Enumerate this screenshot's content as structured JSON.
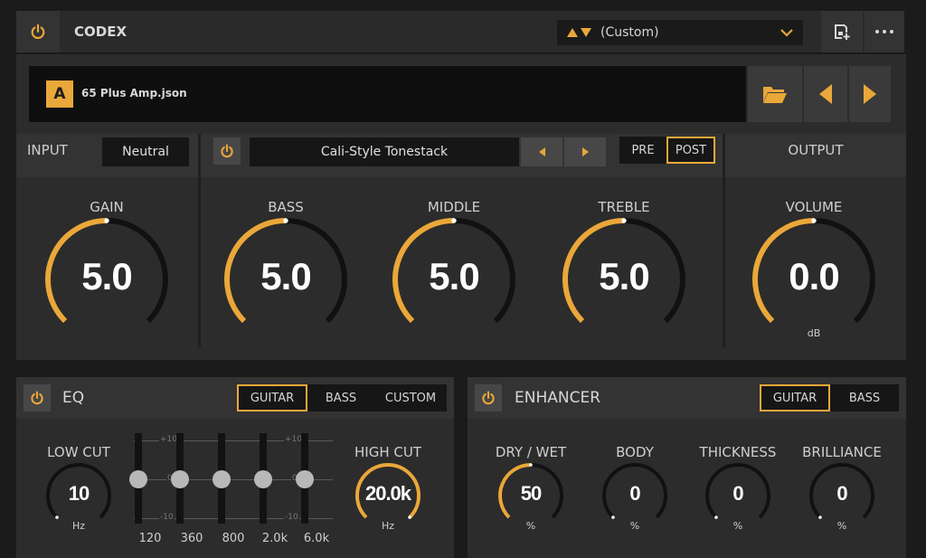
{
  "header": {
    "title": "CODEX",
    "preset": "(Custom)"
  },
  "model": {
    "badge": "A",
    "file": "65 Plus Amp.json"
  },
  "input": {
    "label": "INPUT",
    "mode": "Neutral"
  },
  "tonestack": {
    "name": "Cali-Style Tonestack",
    "pre": "PRE",
    "post": "POST",
    "active": "POST"
  },
  "output": {
    "label": "OUTPUT"
  },
  "knobs": {
    "gain": {
      "label": "GAIN",
      "value": "5.0",
      "level": 0.5
    },
    "bass": {
      "label": "BASS",
      "value": "5.0",
      "level": 0.5
    },
    "middle": {
      "label": "MIDDLE",
      "value": "5.0",
      "level": 0.5
    },
    "treble": {
      "label": "TREBLE",
      "value": "5.0",
      "level": 0.5
    },
    "volume": {
      "label": "VOLUME",
      "value": "0.0",
      "unit": "dB",
      "level": 0.5
    }
  },
  "eq": {
    "title": "EQ",
    "modes": [
      "GUITAR",
      "BASS",
      "CUSTOM"
    ],
    "active": "GUITAR",
    "low_cut": {
      "label": "LOW CUT",
      "value": "10",
      "unit": "Hz",
      "level": 0.0
    },
    "high_cut": {
      "label": "HIGH CUT",
      "value": "20.0k",
      "unit": "Hz",
      "level": 1.0
    },
    "scale_top": "+10",
    "scale_mid": "0",
    "scale_bot": "-10",
    "bands": [
      {
        "freq": "120",
        "gain": 0
      },
      {
        "freq": "360",
        "gain": 0
      },
      {
        "freq": "800",
        "gain": 0
      },
      {
        "freq": "2.0k",
        "gain": 0
      },
      {
        "freq": "6.0k",
        "gain": 0
      }
    ]
  },
  "enhancer": {
    "title": "ENHANCER",
    "modes": [
      "GUITAR",
      "BASS"
    ],
    "active": "GUITAR",
    "knobs": [
      {
        "label": "DRY / WET",
        "value": "50",
        "unit": "%",
        "level": 0.5
      },
      {
        "label": "BODY",
        "value": "0",
        "unit": "%",
        "level": 0.0
      },
      {
        "label": "THICKNESS",
        "value": "0",
        "unit": "%",
        "level": 0.0
      },
      {
        "label": "BRILLIANCE",
        "value": "0",
        "unit": "%",
        "level": 0.0
      }
    ]
  },
  "colors": {
    "accent": "#eaa73a",
    "panel": "#2c2c2c",
    "well": "#161616",
    "track": "#111111"
  }
}
